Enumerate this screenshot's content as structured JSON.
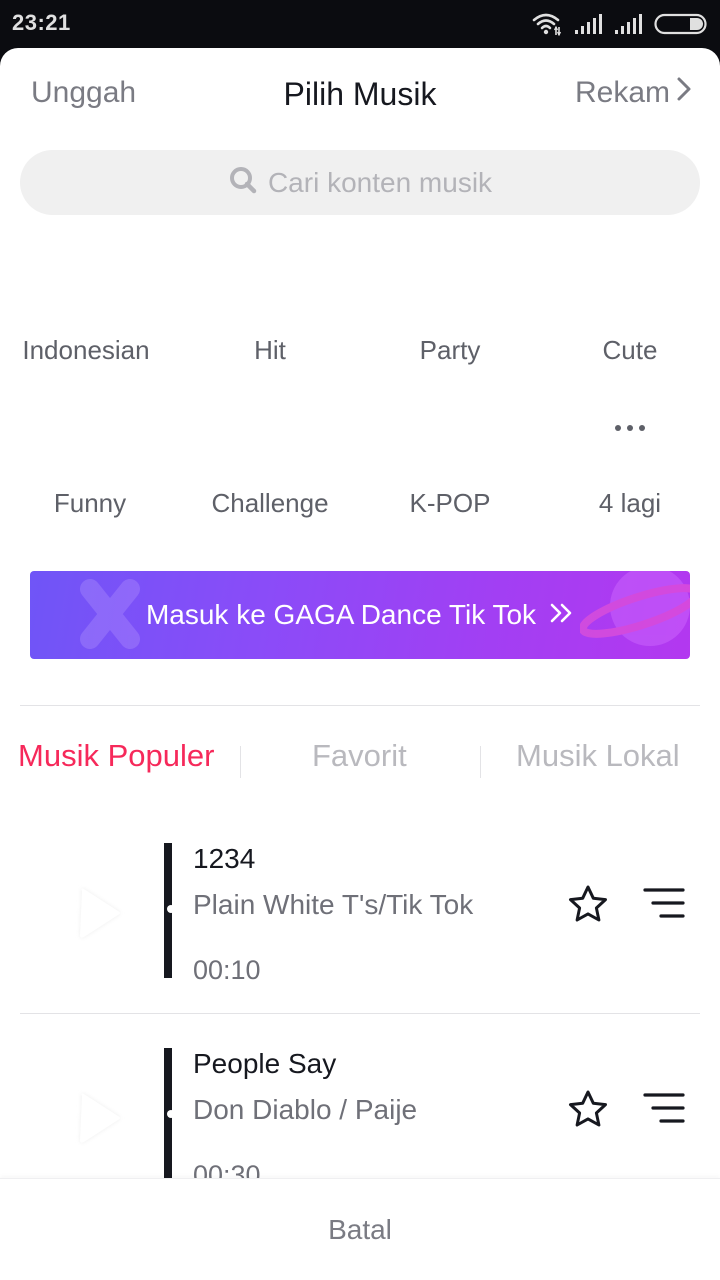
{
  "status_bar": {
    "time": "23:21",
    "icons": [
      "wifi-icon",
      "signal-icon",
      "signal-icon",
      "battery-icon"
    ]
  },
  "header": {
    "left_label": "Unggah",
    "title": "Pilih Musik",
    "right_label": "Rekam",
    "right_icon": "chevron-right-icon"
  },
  "search": {
    "placeholder": "Cari konten musik",
    "icon": "search-icon"
  },
  "categories": {
    "row1": [
      "Indonesian",
      "Hit",
      "Party",
      "Cute"
    ],
    "row2": [
      "Funny",
      "Challenge",
      "K-POP",
      "4 lagi"
    ],
    "more_icon": "more-dots-icon"
  },
  "banner": {
    "label": "Masuk ke GAGA Dance Tik Tok",
    "icon": "double-chevron-right-icon"
  },
  "tabs": [
    {
      "label": "Musik Populer",
      "active": true
    },
    {
      "label": "Favorit",
      "active": false
    },
    {
      "label": "Musik Lokal",
      "active": false
    }
  ],
  "songs": [
    {
      "title": "1234",
      "artist": "Plain White T's/Tik Tok",
      "duration": "00:10"
    },
    {
      "title": "People Say",
      "artist": "Don Diablo / Paije",
      "duration": "00:30"
    }
  ],
  "footer": {
    "cancel_label": "Batal"
  },
  "colors": {
    "accent": "#f6295a",
    "banner_start": "#6f55f7",
    "banner_end": "#b338f0",
    "text_primary": "#16181f",
    "text_secondary": "#7a7b83"
  }
}
